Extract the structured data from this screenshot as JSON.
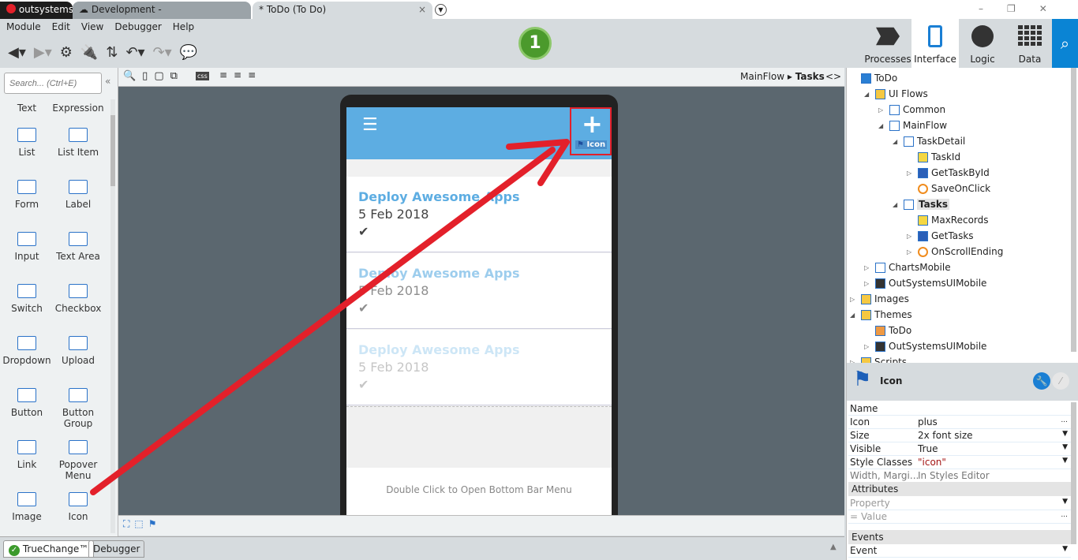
{
  "tabs": {
    "brand": "outsystems",
    "env": "Development -",
    "active": "* ToDo (To Do)",
    "close": "×"
  },
  "menu": [
    "Module",
    "Edit",
    "View",
    "Debugger",
    "Help"
  ],
  "publish_badge": "1",
  "right_tabs": [
    {
      "label": "Processes"
    },
    {
      "label": "Interface",
      "selected": true
    },
    {
      "label": "Logic"
    },
    {
      "label": "Data"
    }
  ],
  "search": {
    "placeholder": "Search... (Ctrl+E)"
  },
  "toolbox": [
    {
      "label": "Text"
    },
    {
      "label": "Expression"
    },
    {
      "label": "List"
    },
    {
      "label": "List Item"
    },
    {
      "label": "Form"
    },
    {
      "label": "Label"
    },
    {
      "label": "Input"
    },
    {
      "label": "Text Area"
    },
    {
      "label": "Switch"
    },
    {
      "label": "Checkbox"
    },
    {
      "label": "Dropdown"
    },
    {
      "label": "Upload"
    },
    {
      "label": "Button"
    },
    {
      "label": "Button Group"
    },
    {
      "label": "Link"
    },
    {
      "label": "Popover Menu"
    },
    {
      "label": "Image"
    },
    {
      "label": "Icon"
    }
  ],
  "breadcrumb": {
    "flow": "MainFlow",
    "screen": "Tasks",
    "toggle": "<>"
  },
  "phone": {
    "icon_tag": "Icon",
    "items": [
      {
        "title": "Deploy Awesome Apps",
        "date": "5 Feb 2018",
        "opacity": 1
      },
      {
        "title": "Deploy Awesome Apps",
        "date": "5 Feb 2018",
        "opacity": 0.6
      },
      {
        "title": "Deploy Awesome Apps",
        "date": "5 Feb 2018",
        "opacity": 0.3
      }
    ],
    "bottom_hint": "Double Click to Open Bottom Bar Menu"
  },
  "tree": [
    {
      "label": "ToDo",
      "level": 0,
      "icon": "module-icon"
    },
    {
      "label": "UI Flows",
      "level": 1,
      "icon": "folder-icon",
      "exp": "◢"
    },
    {
      "label": "Common",
      "level": 2,
      "icon": "flow-icon",
      "exp": "▷"
    },
    {
      "label": "MainFlow",
      "level": 2,
      "icon": "flow-icon",
      "exp": "◢"
    },
    {
      "label": "TaskDetail",
      "level": 3,
      "icon": "screen-icon",
      "exp": "◢"
    },
    {
      "label": "TaskId",
      "level": 4,
      "icon": "input-param-icon"
    },
    {
      "label": "GetTaskById",
      "level": 4,
      "icon": "aggregate-icon",
      "exp": "▷"
    },
    {
      "label": "SaveOnClick",
      "level": 4,
      "icon": "action-icon"
    },
    {
      "label": "Tasks",
      "level": 3,
      "icon": "screen-icon",
      "exp": "◢",
      "selected": true
    },
    {
      "label": "MaxRecords",
      "level": 4,
      "icon": "variable-icon"
    },
    {
      "label": "GetTasks",
      "level": 4,
      "icon": "aggregate-icon",
      "exp": "▷"
    },
    {
      "label": "OnScrollEnding",
      "level": 4,
      "icon": "action-icon",
      "exp": "▷"
    },
    {
      "label": "ChartsMobile",
      "level": 1,
      "icon": "chart-icon",
      "exp": "▷"
    },
    {
      "label": "OutSystemsUIMobile",
      "level": 1,
      "icon": "phone-icon",
      "exp": "▷"
    },
    {
      "label": "Images",
      "level": 0,
      "icon": "folder-icon",
      "exp": "▷"
    },
    {
      "label": "Themes",
      "level": 0,
      "icon": "folder-icon",
      "exp": "◢"
    },
    {
      "label": "ToDo",
      "level": 1,
      "icon": "theme-icon"
    },
    {
      "label": "OutSystemsUIMobile",
      "level": 1,
      "icon": "phone-icon",
      "exp": "▷"
    },
    {
      "label": "Scripts",
      "level": 0,
      "icon": "folder-icon",
      "exp": "▷"
    }
  ],
  "props": {
    "title": "Icon",
    "rows": [
      {
        "k": "Name",
        "v": ""
      },
      {
        "k": "Icon",
        "v": "plus",
        "d": "..."
      },
      {
        "k": "Size",
        "v": "2x font size",
        "d": "▼"
      },
      {
        "k": "Visible",
        "v": "True",
        "d": "▼"
      },
      {
        "k": "Style Classes",
        "v": "\"icon\"",
        "d": "▼"
      },
      {
        "k": "Width, Margi...",
        "v": "In Styles Editor"
      }
    ],
    "attributes": "Attributes",
    "property_ph": "Property",
    "value_ph": "Value",
    "eq": "=",
    "events": "Events",
    "event_ph": "Event"
  },
  "bottom_tabs": [
    "TrueChange™",
    "Debugger"
  ],
  "colors": {
    "accent": "#5dade2",
    "arrow": "#e3202a",
    "search": "#0a84d4"
  }
}
